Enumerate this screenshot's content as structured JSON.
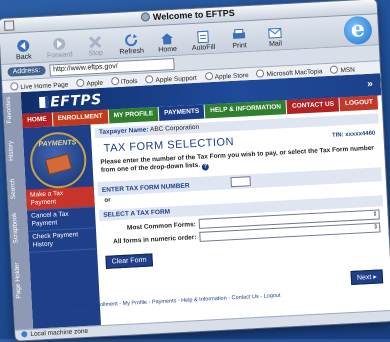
{
  "window": {
    "title": "Welcome to EFTPS"
  },
  "toolbar": {
    "back": "Back",
    "forward": "Forward",
    "stop": "Stop",
    "refresh": "Refresh",
    "home": "Home",
    "autofill": "AutoFill",
    "print": "Print",
    "mail": "Mail"
  },
  "address": {
    "label": "Address:",
    "url": "http://www.eftps.gov/"
  },
  "favorites": [
    "Live Home Page",
    "Apple",
    "iTools",
    "Apple Support",
    "Apple Store",
    "Microsoft MacTopia",
    "MSN"
  ],
  "sidetabs": [
    "Favorites",
    "History",
    "Search",
    "Scrapbook",
    "Page Holder"
  ],
  "site": {
    "logo": "EFTPS",
    "nav": [
      "HOME",
      "ENROLLMENT",
      "MY PROFILE",
      "PAYMENTS",
      "HELP & INFORMATION",
      "CONTACT US",
      "LOGOUT"
    ]
  },
  "left_panel": {
    "badge": "PAYMENTS",
    "links": [
      "Make a Tax Payment",
      "Cancel a Tax Payment",
      "Check Payment History"
    ]
  },
  "main": {
    "taxpayer_label": "Taxpayer Name:",
    "taxpayer_name": "ABC Corporation",
    "title": "TAX FORM SELECTION",
    "tin": "TIN: xxxxx4460",
    "instructions": "Please enter the number of the Tax Form you wish to pay, or select the Tax Form number from one of the drop-down lists.",
    "enter_header": "ENTER TAX FORM NUMBER",
    "or_label": "or",
    "select_header": "SELECT A TAX FORM",
    "most_common_label": "Most Common Forms:",
    "all_forms_label": "All forms in numeric order:",
    "clear_button": "Clear Form",
    "next_button": "Next",
    "footer_links": "Home - Enrollment - My Profile - Payments - Help & Information - Contact Us - Logout"
  },
  "status": {
    "text": "Local machine zone"
  }
}
